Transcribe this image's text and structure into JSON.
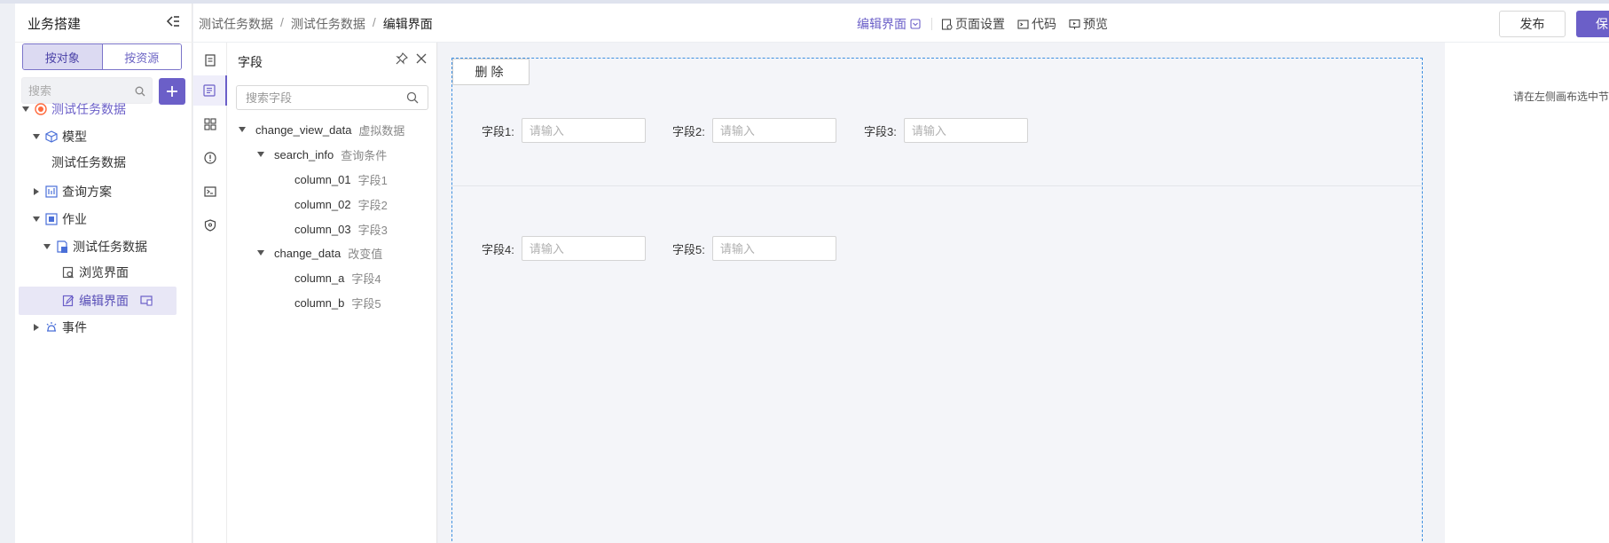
{
  "sidebar": {
    "title": "业务搭建",
    "segments": [
      "按对象",
      "按资源"
    ],
    "search_placeholder": "搜索",
    "tree": {
      "root": "测试任务数据",
      "model": "模型",
      "model_child": "测试任务数据",
      "query_plan": "查询方案",
      "job": "作业",
      "job_child": "测试任务数据",
      "browse_page": "浏览界面",
      "edit_page": "编辑界面",
      "events": "事件"
    }
  },
  "header": {
    "breadcrumb": [
      "测试任务数据",
      "测试任务数据",
      "编辑界面"
    ],
    "tab_edit": "编辑界面",
    "page_settings": "页面设置",
    "code": "代码",
    "preview": "预览",
    "publish": "发布",
    "save": "保"
  },
  "fields_panel": {
    "title": "字段",
    "search_placeholder": "搜索字段",
    "items": [
      {
        "name": "change_view_data",
        "alias": "虚拟数据"
      },
      {
        "name": "search_info",
        "alias": "查询条件"
      },
      {
        "name": "column_01",
        "alias": "字段1"
      },
      {
        "name": "column_02",
        "alias": "字段2"
      },
      {
        "name": "column_03",
        "alias": "字段3"
      },
      {
        "name": "change_data",
        "alias": "改变值"
      },
      {
        "name": "column_a",
        "alias": "字段4"
      },
      {
        "name": "column_b",
        "alias": "字段5"
      }
    ]
  },
  "canvas": {
    "delete": "删除",
    "fields": [
      {
        "label": "字段1:",
        "placeholder": "请输入"
      },
      {
        "label": "字段2:",
        "placeholder": "请输入"
      },
      {
        "label": "字段3:",
        "placeholder": "请输入"
      },
      {
        "label": "字段4:",
        "placeholder": "请输入"
      },
      {
        "label": "字段5:",
        "placeholder": "请输入"
      }
    ]
  },
  "right_panel": {
    "hint": "请在左侧画布选中节"
  },
  "colors": {
    "accent": "#6b5fc8",
    "canvas_border": "#3d8fe0"
  }
}
